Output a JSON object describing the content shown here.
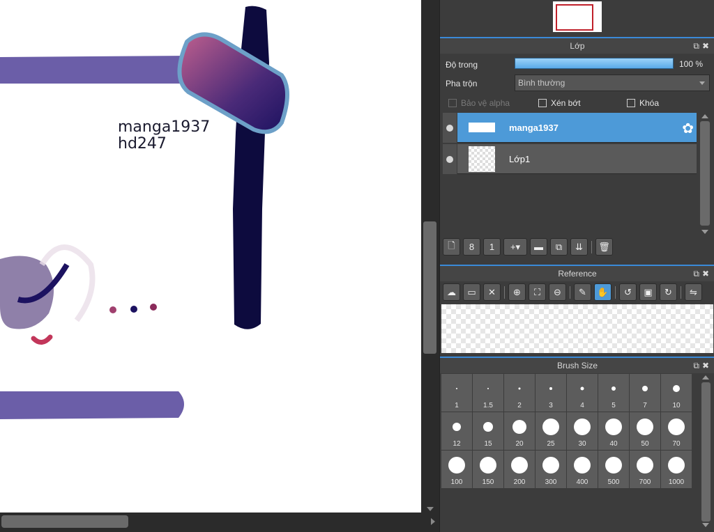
{
  "canvas": {
    "text_line1": "manga1937",
    "text_line2": "hd247"
  },
  "layer_panel": {
    "title": "Lớp",
    "opacity_label": "Độ trong",
    "opacity_value": "100 %",
    "opacity_percent": 100,
    "blend_label": "Pha trộn",
    "blend_value": "Bình thường",
    "protect_alpha_label": "Bảo vệ alpha",
    "clipping_label": "Xén bớt",
    "lock_label": "Khóa",
    "layers": [
      {
        "name": "manga1937",
        "selected": true
      },
      {
        "name": "Lớp1",
        "selected": false
      }
    ]
  },
  "reference_panel": {
    "title": "Reference"
  },
  "brush_panel": {
    "title": "Brush Size",
    "sizes": [
      "1",
      "1.5",
      "2",
      "3",
      "4",
      "5",
      "7",
      "10",
      "12",
      "15",
      "20",
      "25",
      "30",
      "40",
      "50",
      "70",
      "100",
      "150",
      "200",
      "300",
      "400",
      "500",
      "700",
      "1000"
    ]
  },
  "colors": {
    "accent": "#4d9ad8",
    "selection_frame": "#c0202a",
    "stroke_purple": "#6b5ea8",
    "stroke_navy": "#0d0b3e"
  }
}
